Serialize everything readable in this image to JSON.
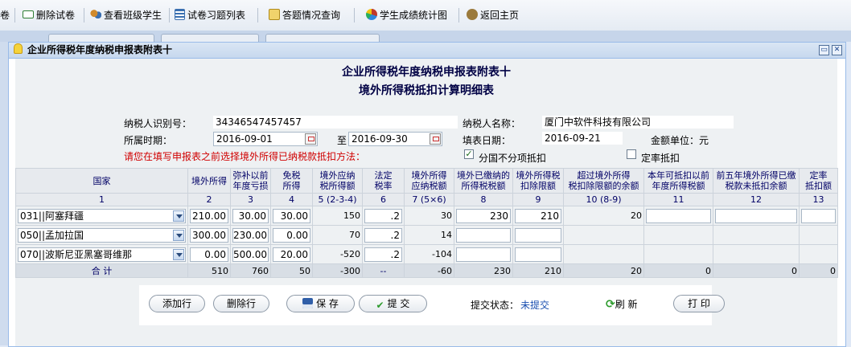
{
  "toolbar": {
    "items": [
      {
        "label": "卷",
        "icon": "edit-icon",
        "color": "#3a7bd5"
      },
      {
        "label": "删除试卷",
        "icon": "delete-icon",
        "color": "#2e7d32"
      },
      {
        "label": "查看班级学生",
        "icon": "users-icon",
        "color": "#d08a2c"
      },
      {
        "label": "试卷习题列表",
        "icon": "list-icon",
        "color": "#3a6fb0"
      },
      {
        "label": "答题情况查询",
        "icon": "search-icon",
        "color": "#c9a227"
      },
      {
        "label": "学生成绩统计图",
        "icon": "pie-chart-icon",
        "color": "#c0392b"
      },
      {
        "label": "返回主页",
        "icon": "home-icon",
        "color": "#7a5c2e"
      }
    ]
  },
  "window": {
    "title": "企业所得税年度纳税申报表附表十"
  },
  "form": {
    "title_line1": "企业所得税年度纳税申报表附表十",
    "title_line2": "境外所得税抵扣计算明细表",
    "taxpayer_id_label": "纳税人识别号：",
    "taxpayer_id": "34346547457457",
    "taxpayer_name_label": "纳税人名称：",
    "taxpayer_name": "厦门中软件科技有限公司",
    "period_label": "所属时期：",
    "period_start": "2016-09-01",
    "period_to": "至",
    "period_end": "2016-09-30",
    "fill_date_label": "填表日期：",
    "fill_date": "2016-09-21",
    "unit_label": "金额单位：元",
    "warning": "请您在填写申报表之前选择境外所得已纳税款抵扣方法：",
    "option1": "分国不分项抵扣",
    "option1_checked": true,
    "option2": "定率抵扣",
    "option2_checked": false
  },
  "table": {
    "headers": [
      "国家",
      "境外所得",
      "弥补以前\n年度亏损",
      "免税\n所得",
      "境外应纳\n税所得额",
      "法定\n税率",
      "境外所得\n应纳税额",
      "境外已缴纳的\n所得税税额",
      "境外所得税\n扣除限额",
      "超过境外所得\n税扣除限额的余额",
      "本年可抵扣以前\n年度所得税额",
      "前五年境外所得已缴\n税款未抵扣余额",
      "定率\n抵扣额"
    ],
    "col_numbers": [
      "1",
      "2",
      "3",
      "4",
      "5 (2-3-4)",
      "6",
      "7 (5×6)",
      "8",
      "9",
      "10 (8-9)",
      "11",
      "12",
      "13"
    ],
    "rows": [
      {
        "country": "031||阿塞拜疆",
        "c2": "210.00",
        "c3": "30.00",
        "c4": "30.00",
        "c5": "150",
        "c6": ".2",
        "c7": "30",
        "c8": "230",
        "c9": "210",
        "c10": "20",
        "c11": "",
        "c12": "",
        "c13": ""
      },
      {
        "country": "050||孟加拉国",
        "c2": "300.00",
        "c3": "230.00",
        "c4": "0.00",
        "c5": "70",
        "c6": ".2",
        "c7": "14",
        "c8": "",
        "c9": "",
        "c10": "",
        "c11": "",
        "c12": "",
        "c13": ""
      },
      {
        "country": "070||波斯尼亚黑塞哥维那",
        "c2": "0.00",
        "c3": "500.00",
        "c4": "20.00",
        "c5": "-520",
        "c6": ".2",
        "c7": "-104",
        "c8": "",
        "c9": "",
        "c10": "",
        "c11": "",
        "c12": "",
        "c13": ""
      }
    ],
    "total": {
      "label": "合 计",
      "c2": "510",
      "c3": "760",
      "c4": "50",
      "c5": "-300",
      "c6": "--",
      "c7": "-60",
      "c8": "230",
      "c9": "210",
      "c10": "20",
      "c11": "0",
      "c12": "0",
      "c13": "0"
    }
  },
  "actions": {
    "add_row": "添加行",
    "delete_row": "删除行",
    "save": "保 存",
    "submit": "提 交",
    "status_label": "提交状态：",
    "status_value": "未提交",
    "refresh": "刷 新",
    "print": "打 印"
  },
  "colors": {
    "warning": "#d00000",
    "status": "#1a4fb0",
    "header_text": "#000066"
  }
}
